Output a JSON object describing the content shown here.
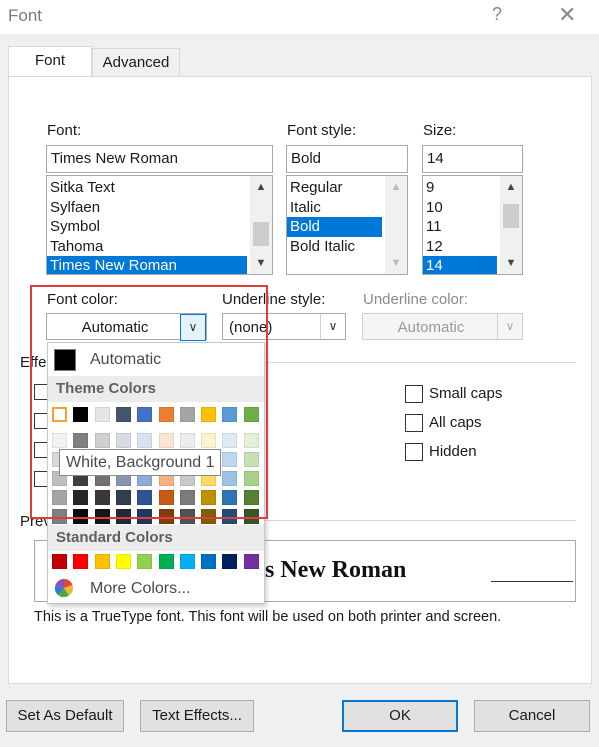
{
  "window": {
    "title": "Font",
    "help_glyph": "?",
    "close_glyph": "✕"
  },
  "tabs": [
    {
      "label": "Font"
    },
    {
      "label": "Advanced"
    }
  ],
  "font": {
    "label": "Font:",
    "value": "Times New Roman",
    "list": [
      "Sitka Text",
      "Sylfaen",
      "Symbol",
      "Tahoma",
      "Times New Roman"
    ],
    "selected": "Times New Roman"
  },
  "font_style": {
    "label": "Font style:",
    "value": "Bold",
    "list": [
      "Regular",
      "Italic",
      "Bold",
      "Bold Italic"
    ],
    "selected": "Bold"
  },
  "size": {
    "label": "Size:",
    "value": "14",
    "list": [
      "9",
      "10",
      "11",
      "12",
      "14"
    ],
    "selected": "14"
  },
  "font_color": {
    "label": "Font color:",
    "value": "Automatic"
  },
  "underline_style": {
    "label": "Underline style:",
    "value": "(none)"
  },
  "underline_color": {
    "label": "Underline color:",
    "value": "Automatic"
  },
  "effects": {
    "label_partial": "Effe",
    "right": [
      {
        "label": "Small caps"
      },
      {
        "label": "All caps"
      },
      {
        "label": "Hidden"
      }
    ]
  },
  "color_popup": {
    "automatic_label": "Automatic",
    "theme_heading": "Theme Colors",
    "theme_colors": [
      [
        "#ffffff",
        "#000000",
        "#e7e6e6",
        "#44546a",
        "#4472c4",
        "#ed7d31",
        "#a5a5a5",
        "#ffc000",
        "#5b9bd5",
        "#70ad47"
      ],
      [
        "#f2f2f2",
        "#7f7f7f",
        "#d0cece",
        "#d6dce4",
        "#d9e2f3",
        "#fbe5d5",
        "#ededed",
        "#fff2cc",
        "#deeaf6",
        "#e2efd9"
      ],
      [
        "#d8d8d8",
        "#595959",
        "#aeabab",
        "#adb9ca",
        "#b4c6e7",
        "#f7caac",
        "#dbdbdb",
        "#fee599",
        "#bdd7ee",
        "#c5e0b3"
      ],
      [
        "#bfbfbf",
        "#3f3f3f",
        "#757070",
        "#8496b0",
        "#8eaadb",
        "#f4b183",
        "#c9c9c9",
        "#ffd965",
        "#9cc3e5",
        "#a8d08d"
      ],
      [
        "#a5a5a5",
        "#262626",
        "#3a3838",
        "#323e4f",
        "#2f5496",
        "#c55a11",
        "#7b7b7b",
        "#bf9000",
        "#2e75b5",
        "#538135"
      ],
      [
        "#7f7f7f",
        "#0c0c0c",
        "#171616",
        "#222a35",
        "#1e3864",
        "#833c0b",
        "#525252",
        "#7f6000",
        "#1f4e79",
        "#375623"
      ]
    ],
    "tooltip": "White, Background 1",
    "standard_heading": "Standard Colors",
    "standard_colors": [
      "#c00000",
      "#ff0000",
      "#ffc000",
      "#ffff00",
      "#92d050",
      "#00b050",
      "#00b0f0",
      "#0070c0",
      "#002060",
      "#7030a0"
    ],
    "more_colors_label": "More Colors..."
  },
  "preview": {
    "label_partial": "Prev",
    "sample_text": "s New Roman"
  },
  "info_text": "This is a TrueType font. This font will be used on both printer and screen.",
  "buttons": {
    "set_default": "Set As Default",
    "text_effects": "Text Effects...",
    "ok": "OK",
    "cancel": "Cancel"
  }
}
